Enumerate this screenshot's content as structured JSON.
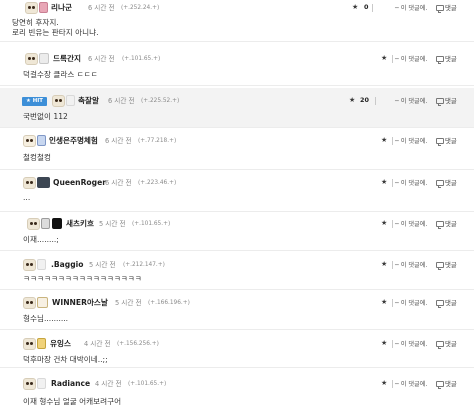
{
  "actions": {
    "reply_link": "─ 이 댓글에.",
    "reply_button": "댓글"
  },
  "comments": [
    {
      "nick": "리나군",
      "time": "6 시간 전",
      "ip": "(+.252.24.+)",
      "score": "0",
      "body": "당연히 후자지.",
      "body2": "로리 빈유는 판타지 아니냐."
    },
    {
      "nick": "드록간지",
      "time": "6 시간 전",
      "ip": "(+.101.65.+)",
      "body": "덕걸수장 클라스 ㄷㄷㄷ"
    },
    {
      "hit": "★ HIT",
      "nick": "축잘알",
      "time": "6 시간 전",
      "ip": "(+.225.52.+)",
      "score": "20",
      "body": "국번없이 112"
    },
    {
      "nick": "인생은주명체험",
      "time": "6 시간 전",
      "ip": "(+.77.218.+)",
      "body": "철컹철컹"
    },
    {
      "nick": "QueenRoger",
      "time": "6 시간 전",
      "ip": "(+.223.46.+)",
      "body": "..."
    },
    {
      "nick": "새츠키흐",
      "time": "5 시간 전",
      "ip": "(+.101.65.+)",
      "body": "이재........;"
    },
    {
      "nick": ".Baggio",
      "time": "5 시간 전",
      "ip": "(+.212.147.+)",
      "body": "ㅋㅋㅋㅋㅋㅋㅋㅋㅋㅋㅋㅋㅋㅋㅋㅋㅋ"
    },
    {
      "nick": "WINNER아스날",
      "time": "5 시간 전",
      "ip": "(+.166.196.+)",
      "body": "형수님.........."
    },
    {
      "nick": "유잉스",
      "time": "4 시간 전",
      "ip": "(+.156.256.+)",
      "body": "덕후마장 건차 대박이네..;;"
    },
    {
      "nick": "Radiance",
      "time": "4 시간 전",
      "ip": "(+.101.65.+)",
      "body": "이재 형수님 얼굴 어캐보려구어"
    }
  ]
}
